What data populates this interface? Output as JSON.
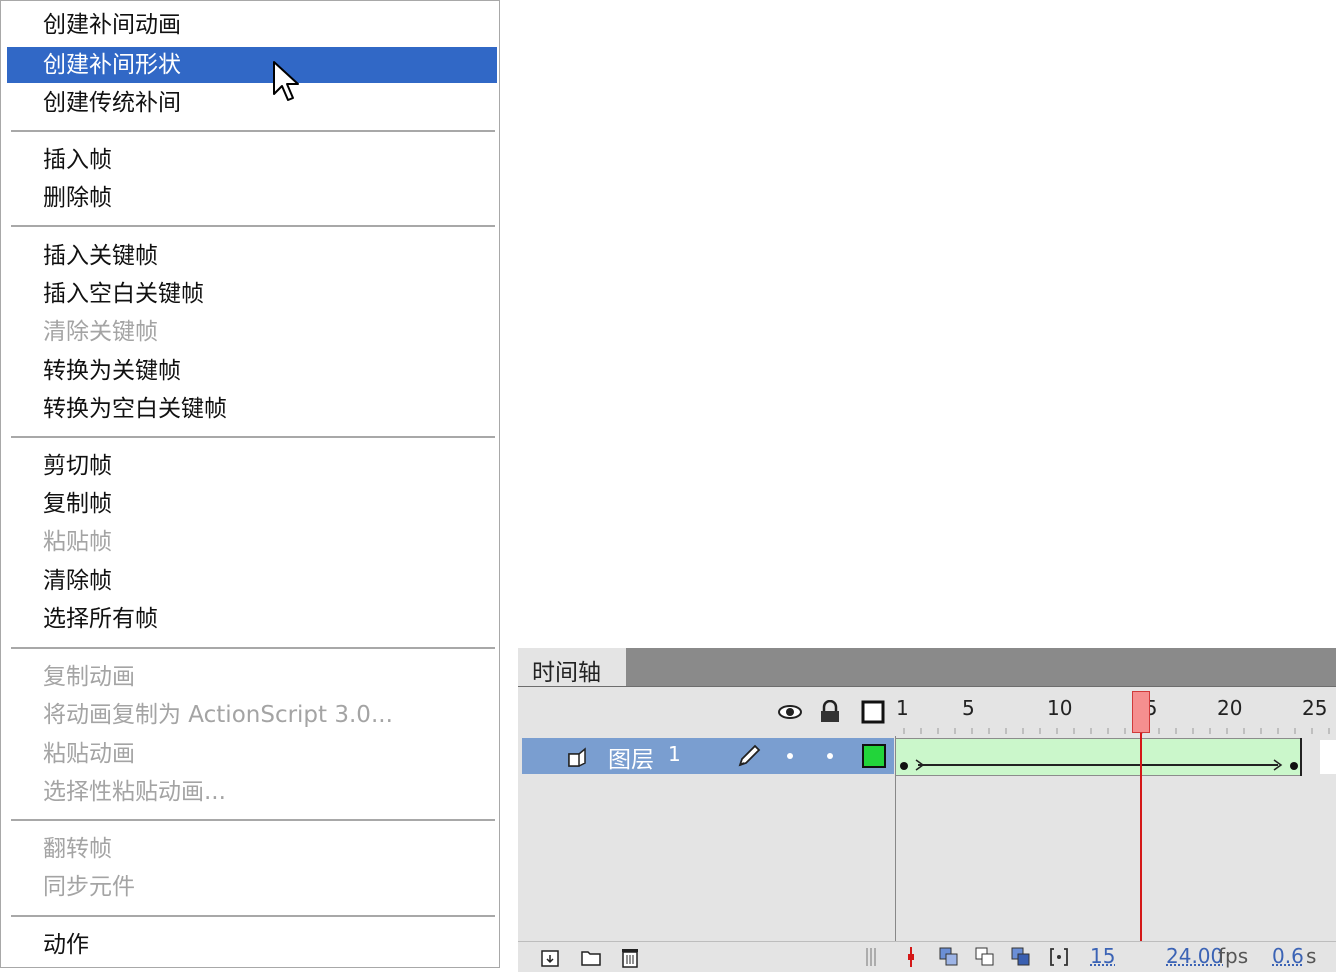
{
  "menu": {
    "items": [
      {
        "label": "创建补间动画",
        "enabled": true
      },
      {
        "label": "创建补间形状",
        "enabled": true,
        "highlighted": true
      },
      {
        "label": "创建传统补间",
        "enabled": true
      },
      {
        "label": "插入帧",
        "enabled": true
      },
      {
        "label": "删除帧",
        "enabled": true
      },
      {
        "label": "插入关键帧",
        "enabled": true
      },
      {
        "label": "插入空白关键帧",
        "enabled": true
      },
      {
        "label": "清除关键帧",
        "enabled": false
      },
      {
        "label": "转换为关键帧",
        "enabled": true
      },
      {
        "label": "转换为空白关键帧",
        "enabled": true
      },
      {
        "label": "剪切帧",
        "enabled": true
      },
      {
        "label": "复制帧",
        "enabled": true
      },
      {
        "label": "粘贴帧",
        "enabled": false
      },
      {
        "label": "清除帧",
        "enabled": true
      },
      {
        "label": "选择所有帧",
        "enabled": true
      },
      {
        "label": "复制动画",
        "enabled": false
      },
      {
        "label": "将动画复制为 ActionScript 3.0...",
        "enabled": false
      },
      {
        "label": "粘贴动画",
        "enabled": false
      },
      {
        "label": "选择性粘贴动画...",
        "enabled": false
      },
      {
        "label": "翻转帧",
        "enabled": false
      },
      {
        "label": "同步元件",
        "enabled": false
      },
      {
        "label": "动作",
        "enabled": true
      }
    ]
  },
  "timeline": {
    "tab_label": "时间轴",
    "header_icons": [
      "eye-icon",
      "lock-icon",
      "outline-icon"
    ],
    "ruler": [
      "1",
      "5",
      "10",
      "15",
      "20",
      "25"
    ],
    "layer": {
      "name": "图层",
      "number": "1",
      "color": "#22d43a"
    },
    "current_frame": "15",
    "fps_value": "24.00",
    "fps_unit": "fps",
    "time_value": "0.6",
    "time_unit": "s",
    "highlight_color": "#3168c6",
    "tween_fill_color": "#cbf7cb"
  }
}
